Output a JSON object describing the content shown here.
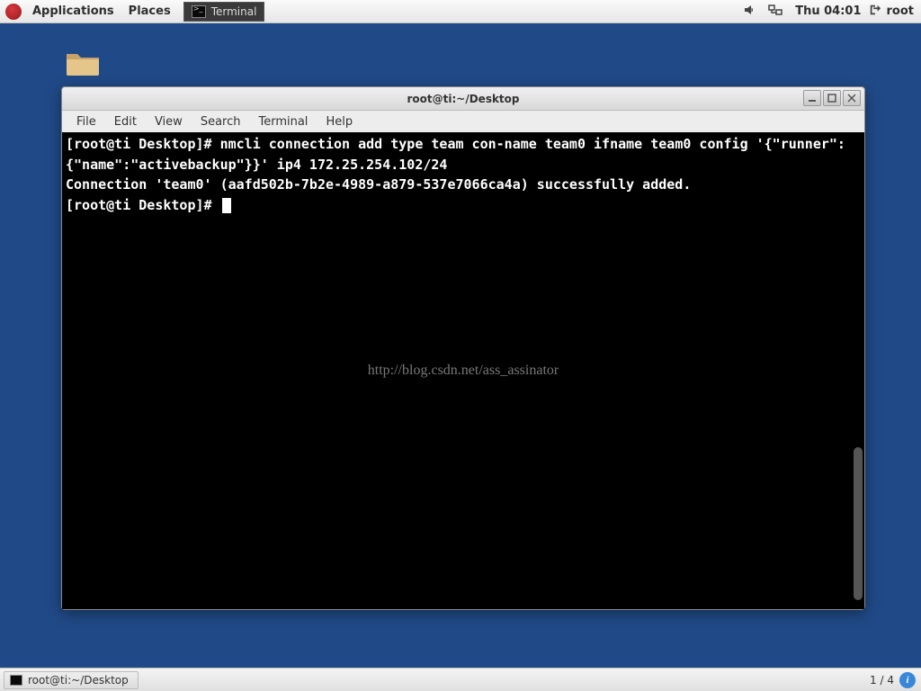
{
  "top_panel": {
    "applications": "Applications",
    "places": "Places",
    "task_label": "Terminal",
    "clock": "Thu 04:01",
    "user": "root"
  },
  "window": {
    "title": "root@ti:~/Desktop",
    "menubar": {
      "file": "File",
      "edit": "Edit",
      "view": "View",
      "search": "Search",
      "terminal": "Terminal",
      "help": "Help"
    },
    "terminal": {
      "line1_prompt": "[root@ti Desktop]# ",
      "line1_cmd": "nmcli connection add type team con-name team0 ifname team0 config '{\"runner\":{\"name\":\"activebackup\"}}' ip4 172.25.254.102/24",
      "line2": "Connection 'team0' (aafd502b-7b2e-4989-a879-537e7066ca4a) successfully added.",
      "line3_prompt": "[root@ti Desktop]# "
    },
    "watermark": "http://blog.csdn.net/ass_assinator"
  },
  "bottom_panel": {
    "task": "root@ti:~/Desktop",
    "workspace": "1 / 4"
  }
}
